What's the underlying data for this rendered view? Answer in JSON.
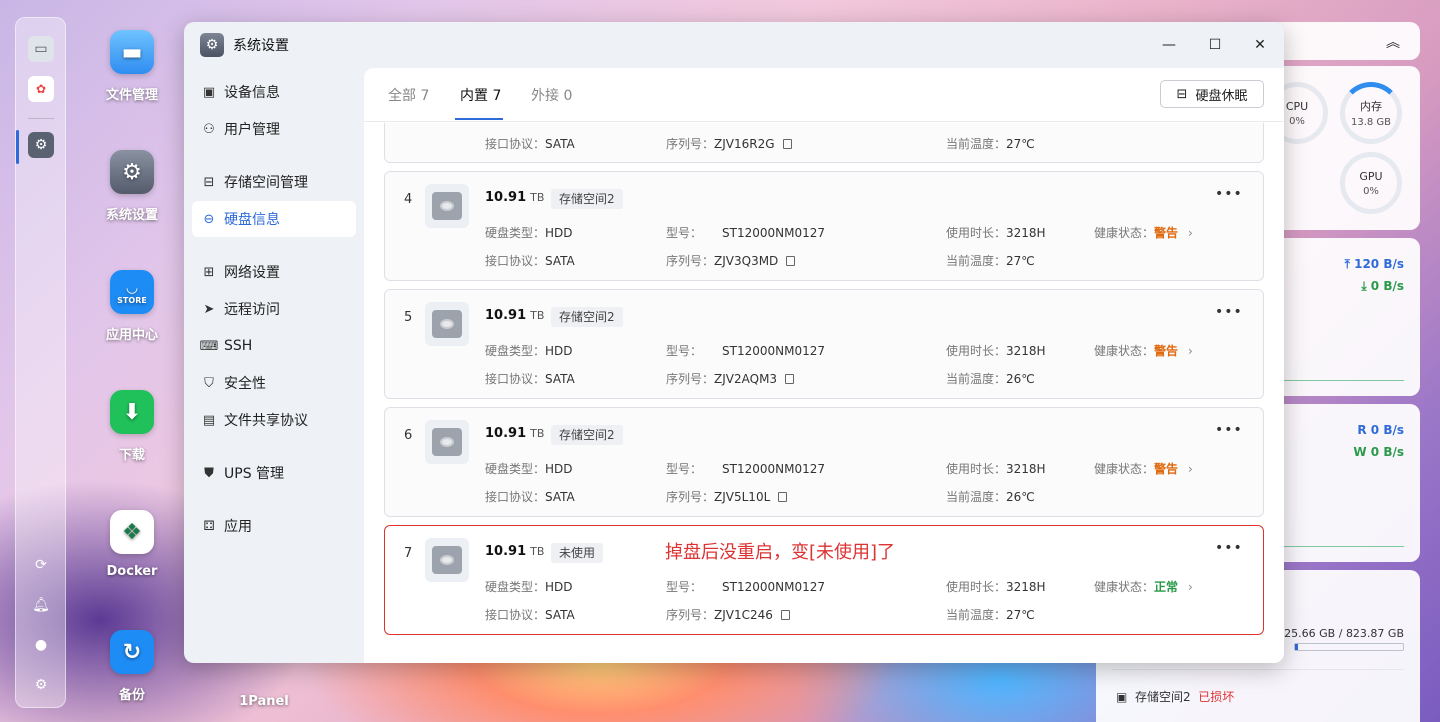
{
  "desktop": {
    "icons": [
      {
        "label": "文件管理"
      },
      {
        "label": "系统设置"
      },
      {
        "label": "应用中心",
        "badge": "STORE"
      },
      {
        "label": "下载"
      },
      {
        "label": "Docker"
      },
      {
        "label": "备份"
      },
      {
        "label": "1Panel"
      }
    ]
  },
  "widgets": {
    "monitor": {
      "cpu_label": "CPU",
      "cpu_value": "0%",
      "mem_label": "内存",
      "mem_value": "13.8 GB",
      "gpu_label": "GPU",
      "gpu_value": "0%"
    },
    "network": {
      "up": "120 B/s",
      "down": "0 B/s"
    },
    "io": {
      "read": "R  0 B/s",
      "write": "W 0 B/s"
    },
    "storage": {
      "used": "25.66 GB",
      "total": "823.87 GB",
      "sep": " / ",
      "item_name": "存储空间2",
      "item_status": "已损坏",
      "used_fraction": 0.031
    }
  },
  "window": {
    "title": "系统设置",
    "sidebar": [
      {
        "label": "设备信息",
        "icon": "device-icon"
      },
      {
        "label": "用户管理",
        "icon": "user-icon"
      },
      {
        "label": "存储空间管理",
        "icon": "storage-icon"
      },
      {
        "label": "硬盘信息",
        "icon": "disk-icon",
        "active": true
      },
      {
        "label": "网络设置",
        "icon": "network-icon"
      },
      {
        "label": "远程访问",
        "icon": "send-icon"
      },
      {
        "label": "SSH",
        "icon": "terminal-icon"
      },
      {
        "label": "安全性",
        "icon": "shield-icon"
      },
      {
        "label": "文件共享协议",
        "icon": "file-icon"
      },
      {
        "label": "UPS 管理",
        "icon": "ups-icon"
      },
      {
        "label": "应用",
        "icon": "apps-icon"
      }
    ],
    "tabs": [
      {
        "label": "全部 7"
      },
      {
        "label": "内置 7",
        "active": true
      },
      {
        "label": "外接 0"
      }
    ],
    "sleep_button": "硬盘休眠",
    "labels": {
      "disk_type": "硬盘类型：",
      "interface": "接口协议：",
      "model": "型号：",
      "serial": "序列号：",
      "usage": "使用时长：",
      "temperature": "当前温度：",
      "health": "健康状态：",
      "tb": "TB"
    },
    "partial_card": {
      "interface": "SATA",
      "serial": "ZJV16R2G",
      "temperature": "27℃"
    },
    "disks": [
      {
        "index": "4",
        "size": "10.91",
        "tag": "存储空间2",
        "type": "HDD",
        "interface": "SATA",
        "model": "ST12000NM0127",
        "serial": "ZJV3Q3MD",
        "usage": "3218H",
        "temperature": "27℃",
        "health": "警告",
        "health_level": "warn"
      },
      {
        "index": "5",
        "size": "10.91",
        "tag": "存储空间2",
        "type": "HDD",
        "interface": "SATA",
        "model": "ST12000NM0127",
        "serial": "ZJV2AQM3",
        "usage": "3218H",
        "temperature": "26℃",
        "health": "警告",
        "health_level": "warn"
      },
      {
        "index": "6",
        "size": "10.91",
        "tag": "存储空间2",
        "type": "HDD",
        "interface": "SATA",
        "model": "ST12000NM0127",
        "serial": "ZJV5L10L",
        "usage": "3218H",
        "temperature": "26℃",
        "health": "警告",
        "health_level": "warn"
      },
      {
        "index": "7",
        "size": "10.91",
        "tag": "未使用",
        "type": "HDD",
        "interface": "SATA",
        "model": "ST12000NM0127",
        "serial": "ZJV1C246",
        "usage": "3218H",
        "temperature": "27℃",
        "health": "正常",
        "health_level": "ok",
        "note": "掉盘后没重启，变[未使用]了"
      }
    ]
  },
  "colors": {
    "accent": "#2f6bd8",
    "warn": "#e06a0f",
    "ok": "#2a9a4a",
    "annotation": "#dd3333"
  }
}
